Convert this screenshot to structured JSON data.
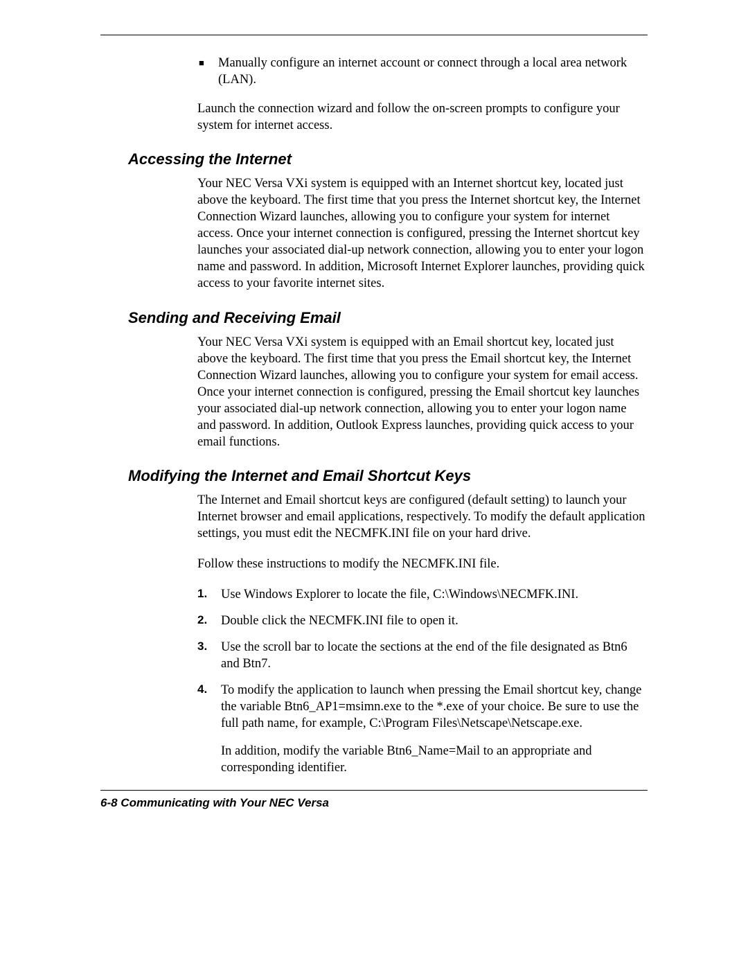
{
  "top_bullet": "Manually configure an internet account or connect through a local area network (LAN).",
  "top_para": "Launch the connection wizard and follow the on-screen prompts to configure your system for internet access.",
  "s1": {
    "heading": "Accessing the Internet",
    "body": "Your NEC Versa VXi system is equipped with an Internet shortcut key, located just above the keyboard. The first time that you press the Internet shortcut key, the Internet Connection Wizard launches, allowing you to configure your system for internet access. Once your internet connection is configured, pressing the Internet shortcut key launches your associated dial-up network connection, allowing you to enter your logon name and password. In addition, Microsoft Internet Explorer launches, providing quick access to your favorite internet sites."
  },
  "s2": {
    "heading": "Sending and Receiving Email",
    "body": "Your NEC Versa VXi system is equipped with an Email shortcut key, located just above the keyboard. The first time that you press the Email shortcut key, the Internet Connection Wizard launches, allowing you to configure your system for email access. Once your internet connection is configured, pressing the Email shortcut key launches your associated dial-up network connection, allowing you to enter your logon name and password. In addition, Outlook Express launches, providing quick access to your email functions."
  },
  "s3": {
    "heading": "Modifying the Internet and Email Shortcut Keys",
    "p1": "The Internet and Email shortcut keys are configured (default setting) to launch your Internet browser and email applications, respectively. To modify the default application settings, you must edit the NECMFK.INI file on your hard drive.",
    "p2": "Follow these instructions to modify the NECMFK.INI file.",
    "steps": [
      {
        "n": "1.",
        "t": "Use Windows Explorer to locate the file, C:\\Windows\\NECMFK.INI."
      },
      {
        "n": "2.",
        "t": "Double click the NECMFK.INI file to open it."
      },
      {
        "n": "3.",
        "t": "Use the scroll bar to locate the sections at the end of the file designated as Btn6 and Btn7."
      },
      {
        "n": "4.",
        "t": "To modify the application to launch when pressing the Email shortcut key, change the variable Btn6_AP1=msimn.exe to the *.exe of your choice. Be sure to use the full path name, for example, C:\\Program Files\\Netscape\\Netscape.exe.",
        "extra": "In addition, modify the variable Btn6_Name=Mail to an appropriate and corresponding identifier."
      }
    ]
  },
  "footer": "6-8   Communicating with Your NEC Versa"
}
